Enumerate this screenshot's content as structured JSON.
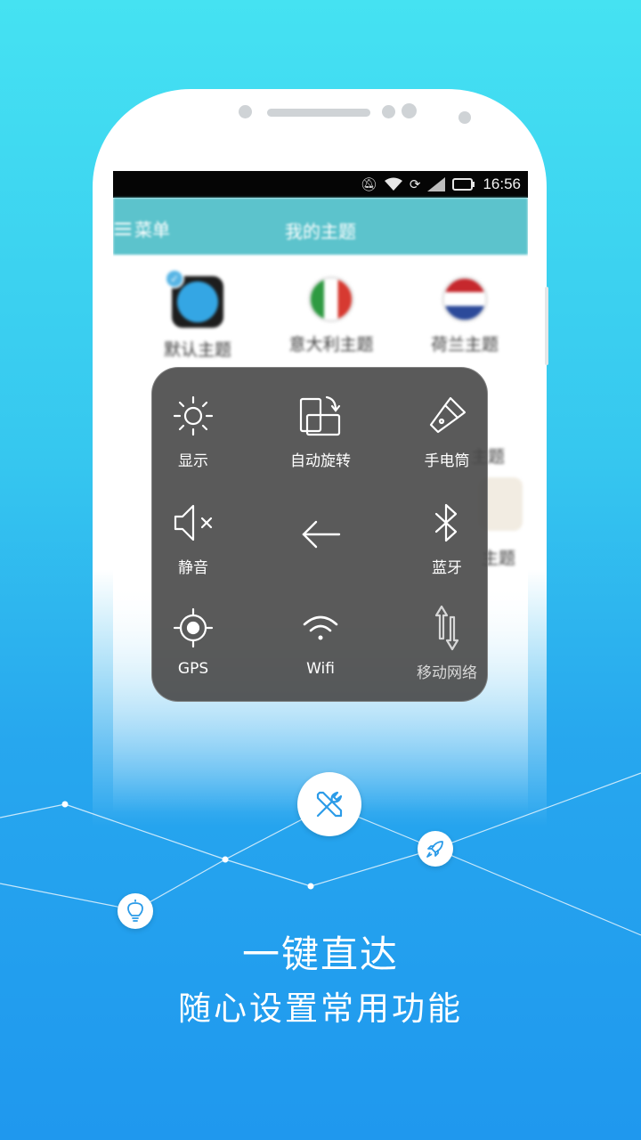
{
  "status_bar": {
    "time": "16:56",
    "icons": [
      "mute-icon",
      "wifi-icon",
      "sync-icon",
      "signal-icon",
      "battery-icon"
    ]
  },
  "app_bar": {
    "menu_label": "菜单",
    "title": "我的主题"
  },
  "themes": [
    {
      "label": "默认主题",
      "icon": "default-theme-icon",
      "selected": true
    },
    {
      "label": "意大利主题",
      "icon": "italy-flag-icon"
    },
    {
      "label": "荷兰主题",
      "icon": "netherlands-flag-icon"
    }
  ],
  "themes_partial": [
    "主题",
    "主题"
  ],
  "quick_panel": {
    "items": [
      {
        "label": "显示",
        "icon": "brightness-icon"
      },
      {
        "label": "自动旋转",
        "icon": "auto-rotate-icon"
      },
      {
        "label": "手电筒",
        "icon": "flashlight-icon"
      },
      {
        "label": "静音",
        "icon": "mute-speaker-icon"
      },
      {
        "label": "",
        "icon": "back-arrow-icon"
      },
      {
        "label": "蓝牙",
        "icon": "bluetooth-icon"
      },
      {
        "label": "GPS",
        "icon": "gps-icon"
      },
      {
        "label": "Wifi",
        "icon": "wifi-icon"
      },
      {
        "label": "移动网络",
        "icon": "mobile-data-icon"
      }
    ]
  },
  "promo": {
    "headline": "一键直达",
    "subline": "随心设置常用功能"
  },
  "colors": {
    "bg_top": "#45e2f2",
    "bg_bottom": "#1f98ee",
    "app_bar": "#5cc3cc",
    "panel": "#484848"
  }
}
